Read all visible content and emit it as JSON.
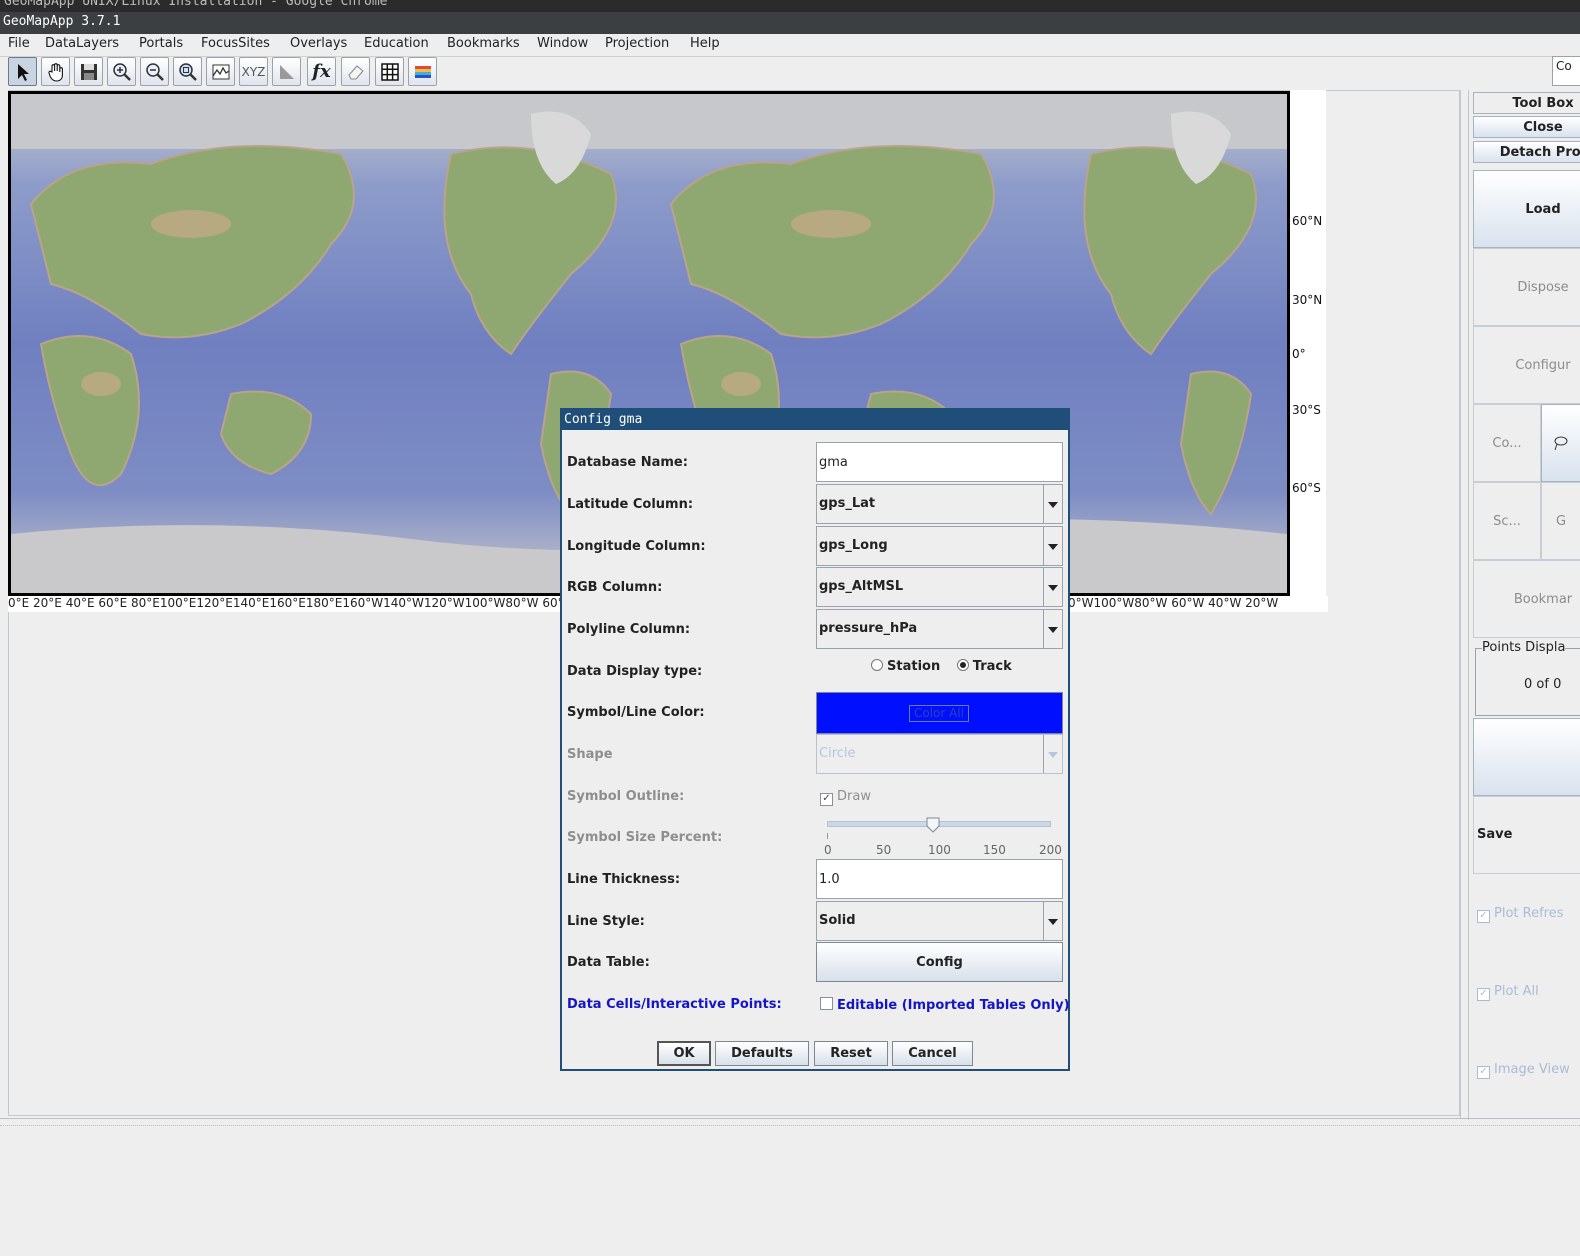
{
  "window": {
    "chrome_title": "GeoMapApp UNIX/Linux Installation - Google Chrome",
    "app_title": "GeoMapApp 3.7.1"
  },
  "menubar": [
    "File",
    "DataLayers",
    "Portals",
    "FocusSites",
    "Overlays",
    "Education",
    "Bookmarks",
    "Window",
    "Projection",
    "Help"
  ],
  "toolbar": {
    "tools": [
      "select-arrow-icon",
      "pan-hand-icon",
      "save-disk-icon",
      "zoom-in-icon",
      "zoom-out-icon",
      "zoom-reset-icon",
      "profile-icon",
      "xyz-icon",
      "flag-icon",
      "function-icon",
      "eraser-icon",
      "grid-icon",
      "layers-icon"
    ],
    "xyz_text": "XYZ",
    "fx_text": "fx",
    "right_edge_text": "Co"
  },
  "map": {
    "lat_labels": [
      "60°N",
      "30°N",
      "0°",
      "30°S",
      "60°S"
    ],
    "lon_labels_text": "0°E 20°E 40°E 60°E 80°E100°E120°E140°E160°E180°E160°W140°W120°W100°W80°W 60°W",
    "lon_labels_right": "0°W100°W80°W 60°W 40°W 20°W"
  },
  "right_panel": {
    "tool_box": "Tool Box",
    "close": "Close",
    "detach": "Detach Prof",
    "load": "Load",
    "dispose": "Dispose",
    "configure": "Configur",
    "co": "Co...",
    "sc": "Sc...",
    "g": "G",
    "bookmark": "Bookmar",
    "points_display_title": "Points Displa",
    "points_count": "0 of 0",
    "save": "Save",
    "plot_refresh": "Plot Refres",
    "plot_all": "Plot All",
    "image_view": "Image View"
  },
  "dialog": {
    "title": "Config gma",
    "database_name_label": "Database Name:",
    "database_name_value": "gma",
    "latitude_label": "Latitude Column:",
    "latitude_value": "gps_Lat",
    "longitude_label": "Longitude Column:",
    "longitude_value": "gps_Long",
    "rgb_label": "RGB Column:",
    "rgb_value": "gps_AltMSL",
    "polyline_label": "Polyline Column:",
    "polyline_value": "pressure_hPa",
    "display_type_label": "Data Display type:",
    "display_station": "Station",
    "display_track": "Track",
    "display_selected": "Track",
    "color_label": "Symbol/Line Color:",
    "color_button": "Color All",
    "color_value": "#0010ff",
    "shape_label": "Shape",
    "shape_value": "Circle",
    "outline_label": "Symbol Outline:",
    "outline_check": "Draw",
    "size_label": "Symbol Size Percent:",
    "size_ticks": [
      "0",
      "50",
      "100",
      "150",
      "200"
    ],
    "size_value": 100,
    "thickness_label": "Line Thickness:",
    "thickness_value": "1.0",
    "line_style_label": "Line Style:",
    "line_style_value": "Solid",
    "data_table_label": "Data Table:",
    "data_table_button": "Config",
    "cells_label": "Data Cells/Interactive Points:",
    "cells_check": "Editable (Imported Tables Only)",
    "ok": "OK",
    "defaults": "Defaults",
    "reset": "Reset",
    "cancel": "Cancel"
  },
  "colors": {
    "dialog_title_bg": "#1f4e79",
    "accent_blue": "#1515c8",
    "disabled_text": "#8e8e8e"
  }
}
